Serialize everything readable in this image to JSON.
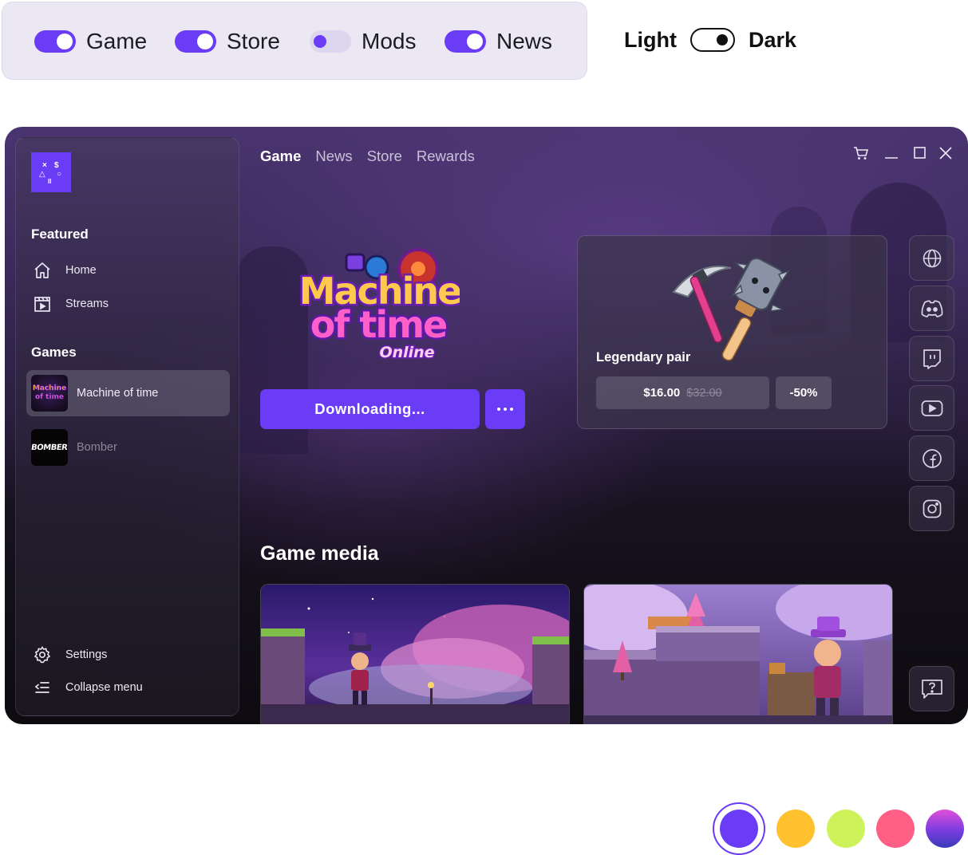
{
  "feature_toggles": [
    {
      "label": "Game",
      "on": true
    },
    {
      "label": "Store",
      "on": true
    },
    {
      "label": "Mods",
      "on": false
    },
    {
      "label": "News",
      "on": true
    }
  ],
  "theme_toggle": {
    "light_label": "Light",
    "dark_label": "Dark",
    "selected": "dark"
  },
  "window": {
    "nav_tabs": [
      {
        "label": "Game",
        "active": true
      },
      {
        "label": "News",
        "active": false
      },
      {
        "label": "Store",
        "active": false
      },
      {
        "label": "Rewards",
        "active": false
      }
    ],
    "controls": [
      "cart-icon",
      "minimize-icon",
      "maximize-icon",
      "close-icon"
    ],
    "sidebar": {
      "logo_glyphs": [
        "×",
        "$",
        "△",
        "○",
        "II"
      ],
      "featured_title": "Featured",
      "featured_items": [
        {
          "label": "Home",
          "icon": "home-icon"
        },
        {
          "label": "Streams",
          "icon": "streams-icon"
        }
      ],
      "games_title": "Games",
      "games": [
        {
          "label": "Machine of time",
          "active": true,
          "thumb_text": "Machine of time"
        },
        {
          "label": "Bomber",
          "active": false,
          "thumb_text": "BOMBER"
        }
      ],
      "bottom_items": [
        {
          "label": "Settings",
          "icon": "gear-icon"
        },
        {
          "label": "Collapse menu",
          "icon": "collapse-menu-icon"
        }
      ]
    },
    "game": {
      "logo_line1": "Machine",
      "logo_line2": "of time",
      "logo_line3": "Online",
      "download_label": "Downloading..."
    },
    "offer": {
      "title": "Legendary pair",
      "price": "$16.00",
      "old_price": "$32.00",
      "discount": "-50%"
    },
    "social": [
      "globe-icon",
      "discord-icon",
      "twitch-icon",
      "youtube-icon",
      "facebook-icon",
      "instagram-icon"
    ],
    "help_icon": "help-icon",
    "media_title": "Game media"
  },
  "colors": {
    "accent": "#6a3cf5",
    "swatches": [
      "#6a3cf5",
      "#ffc12e",
      "#cdf25a",
      "#ff5f84",
      "gradient-purple"
    ]
  }
}
